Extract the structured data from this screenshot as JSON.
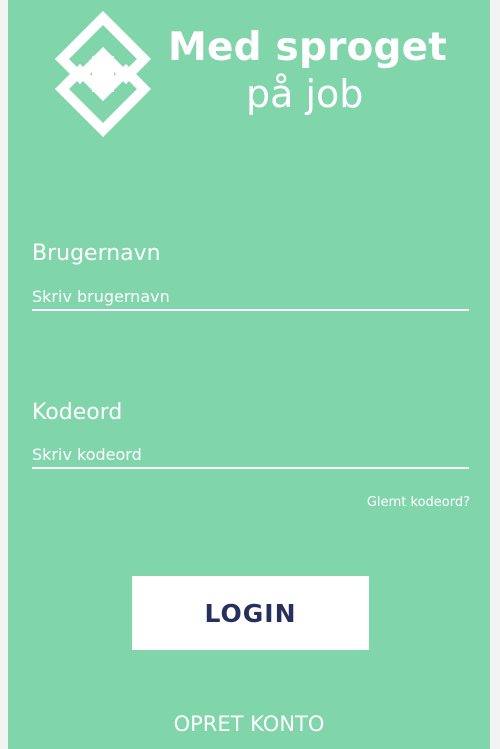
{
  "colors": {
    "background": "#80d5aa",
    "text": "#ffffff",
    "button_text": "#27305c",
    "button_bg": "#ffffff",
    "outer": "#f3f3f3"
  },
  "logo": {
    "icon": "interlocked-s-logo-icon",
    "title_line1": "Med sproget",
    "title_line2": "på job"
  },
  "form": {
    "username_label": "Brugernavn",
    "username_placeholder": "Skriv brugernavn",
    "username_value": "",
    "password_label": "Kodeord",
    "password_placeholder": "Skriv kodeord",
    "password_value": "",
    "forgot_password": "Glemt kodeord?",
    "login_button": "LOGIN",
    "create_account": "OPRET KONTO"
  }
}
